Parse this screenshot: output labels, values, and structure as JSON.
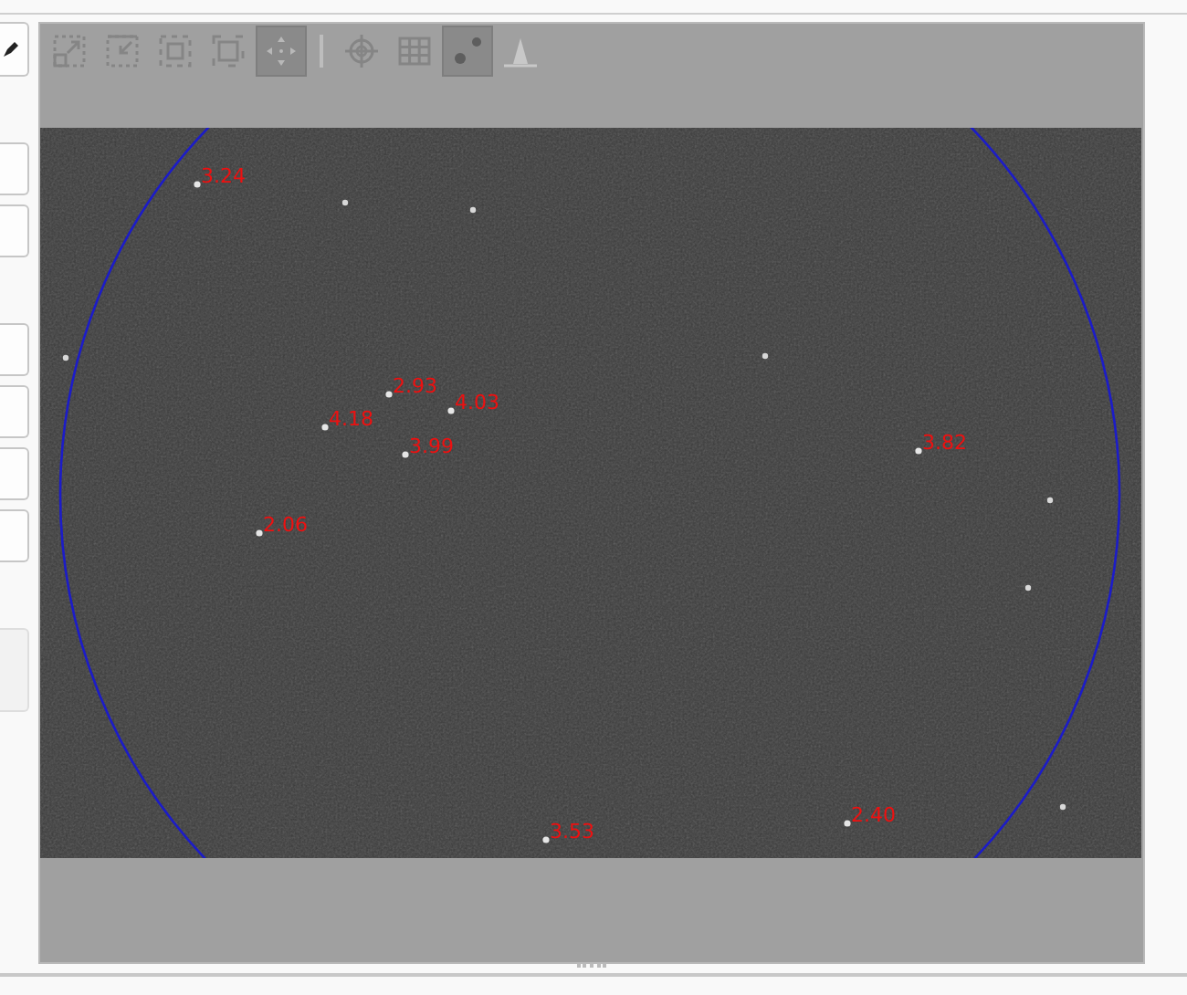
{
  "toolbar": {
    "tools": [
      {
        "kind": "zoom-in",
        "selected": false
      },
      {
        "kind": "zoom-out",
        "selected": false
      },
      {
        "kind": "fit",
        "selected": false
      },
      {
        "kind": "actual-size",
        "selected": false
      },
      {
        "kind": "pan",
        "selected": true
      },
      {
        "kind": "separator"
      },
      {
        "kind": "crosshair",
        "selected": false
      },
      {
        "kind": "grid",
        "selected": false
      },
      {
        "kind": "stars",
        "selected": true
      },
      {
        "kind": "histogram",
        "selected": false
      }
    ]
  },
  "star_labels": [
    {
      "text": "3.24"
    },
    {
      "text": "2.93"
    },
    {
      "text": "4.03"
    },
    {
      "text": "4.18"
    },
    {
      "text": "3.99"
    },
    {
      "text": "2.06"
    },
    {
      "text": "3.82"
    },
    {
      "text": "2.40"
    },
    {
      "text": "3.53"
    }
  ],
  "field_circle": {
    "visible": true
  }
}
